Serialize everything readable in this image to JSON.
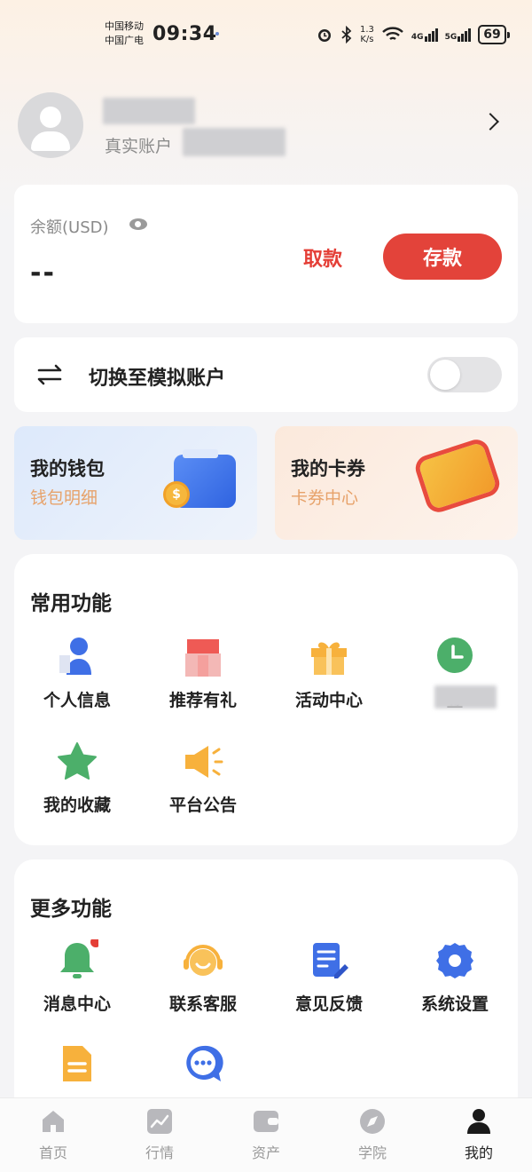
{
  "status_bar": {
    "carrier1": "中国移动",
    "carrier2": "中国广电",
    "time": "09:34",
    "net_speed_value": "1.3",
    "net_speed_unit": "K/s",
    "signal1": "4G",
    "signal2": "5G",
    "battery": "69"
  },
  "profile": {
    "account_type": "真实账户"
  },
  "balance": {
    "label": "余额(USD)",
    "value": "--",
    "withdraw_label": "取款",
    "deposit_label": "存款",
    "accent_color": "#e3433a"
  },
  "switch_account": {
    "label": "切换至模拟账户",
    "enabled": false
  },
  "promos": {
    "wallet": {
      "title": "我的钱包",
      "subtitle": "钱包明细"
    },
    "coupons": {
      "title": "我的卡券",
      "subtitle": "卡券中心"
    }
  },
  "common_functions": {
    "title": "常用功能",
    "items": [
      {
        "label": "个人信息",
        "icon": "person-icon"
      },
      {
        "label": "推荐有礼",
        "icon": "gift-box-icon"
      },
      {
        "label": "活动中心",
        "icon": "gift-icon"
      },
      {
        "label": "签",
        "icon": "clock-icon"
      },
      {
        "label": "我的收藏",
        "icon": "star-icon"
      },
      {
        "label": "平台公告",
        "icon": "megaphone-icon"
      }
    ]
  },
  "more_functions": {
    "title": "更多功能",
    "items": [
      {
        "label": "消息中心",
        "icon": "bell-icon"
      },
      {
        "label": "联系客服",
        "icon": "headset-icon"
      },
      {
        "label": "意见反馈",
        "icon": "feedback-icon"
      },
      {
        "label": "系统设置",
        "icon": "gear-icon"
      },
      {
        "label": "",
        "icon": "document-icon"
      },
      {
        "label": "",
        "icon": "chat-icon"
      }
    ]
  },
  "bottom_nav": {
    "items": [
      {
        "label": "首页",
        "icon": "home-icon",
        "active": false
      },
      {
        "label": "行情",
        "icon": "chart-icon",
        "active": false
      },
      {
        "label": "资产",
        "icon": "wallet-icon",
        "active": false
      },
      {
        "label": "学院",
        "icon": "compass-icon",
        "active": false
      },
      {
        "label": "我的",
        "icon": "user-icon",
        "active": true
      }
    ]
  }
}
